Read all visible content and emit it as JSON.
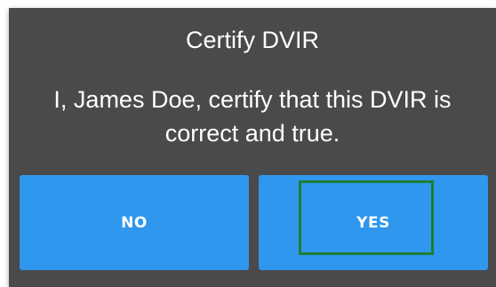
{
  "dialog": {
    "title": "Certify DVIR",
    "message": "I, James Doe, certify that this DVIR is correct and true.",
    "buttons": {
      "no_label": "NO",
      "yes_label": "YES"
    }
  },
  "colors": {
    "dialog_background": "#4a4a4a",
    "button_background": "#2f97ee",
    "highlight_border": "#1e7e34",
    "text": "#ffffff"
  }
}
